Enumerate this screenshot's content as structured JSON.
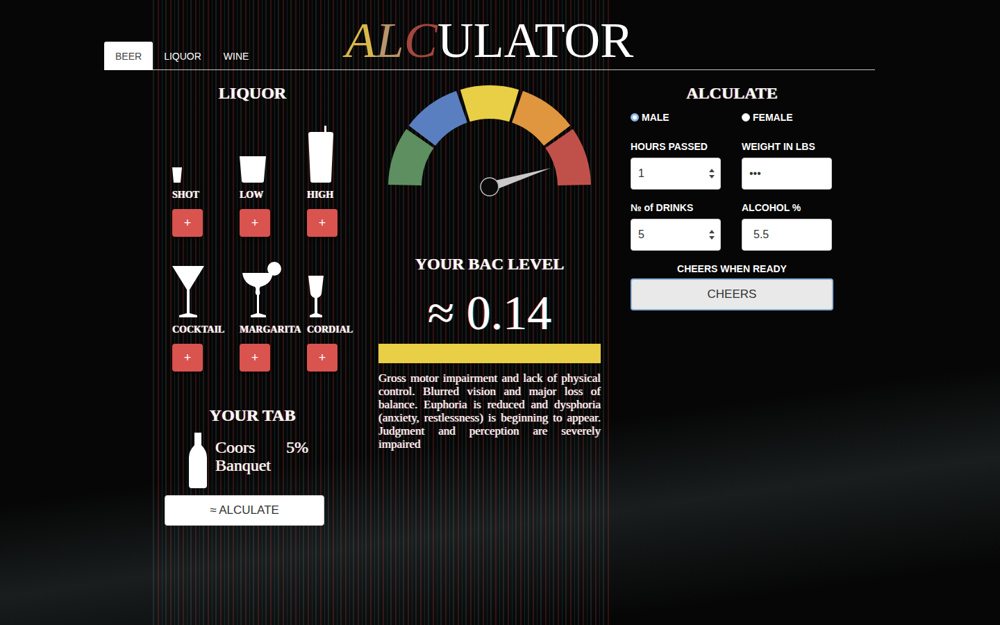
{
  "logo": [
    {
      "text": "A",
      "color": "#d9b94c",
      "italic": true
    },
    {
      "text": "L",
      "color": "#b8946a",
      "italic": true
    },
    {
      "text": "C",
      "color": "#a4473d",
      "italic": true
    },
    {
      "text": "ULATOR",
      "color": "#ffffff",
      "italic": false
    }
  ],
  "tabs": [
    {
      "label": "BEER",
      "selected": true
    },
    {
      "label": "LIQUOR",
      "selected": false
    },
    {
      "label": "WINE",
      "selected": false
    }
  ],
  "liquor": {
    "title": "LIQUOR",
    "drinks": [
      {
        "name": "SHOT",
        "kind": "shot",
        "button": "+"
      },
      {
        "name": "LOW",
        "kind": "low",
        "button": "+"
      },
      {
        "name": "HIGH",
        "kind": "high",
        "button": "+"
      },
      {
        "name": "COCKTAIL",
        "kind": "cocktail",
        "button": "+"
      },
      {
        "name": "MARGARITA",
        "kind": "margarita",
        "button": "+"
      },
      {
        "name": "CORDIAL",
        "kind": "cordial",
        "button": "+"
      }
    ]
  },
  "tab": {
    "title": "YOUR TAB",
    "items": [
      {
        "name": "Coors Banquet",
        "abv": "5%"
      }
    ],
    "button": "≈ ALCULATE"
  },
  "meter": {
    "segments": [
      {
        "color": "#5e8f60"
      },
      {
        "color": "#5a7fc0"
      },
      {
        "color": "#e8cf45"
      },
      {
        "color": "#e0963e"
      },
      {
        "color": "#c0514a"
      }
    ],
    "level": 0.905,
    "title": "YOUR BAC LEVEL",
    "reading": "≈ 0.14",
    "color": "#e8cf45",
    "description": "Gross motor impairment and lack of physical control. Blurred vision and major loss of balance. Euphoria is reduced and dysphoria (anxiety, restlessness) is beginning to appear. Judgment and perception are severely impaired"
  },
  "form": {
    "title": "ALCULATE",
    "genders": [
      {
        "label": "MALE",
        "selected": true
      },
      {
        "label": "FEMALE",
        "selected": false
      }
    ],
    "fields": [
      {
        "label": "HOURS PASSED",
        "value": "1",
        "kind": "number"
      },
      {
        "label": "WEIGHT IN LBS",
        "value": "•••",
        "kind": "password"
      },
      {
        "label": "№ of DRINKS",
        "value": "5",
        "kind": "number"
      },
      {
        "label": "ALCOHOL %",
        "value": "5.5",
        "kind": "text"
      }
    ],
    "prompt": "CHEERS WHEN READY",
    "button": "CHEERS"
  }
}
